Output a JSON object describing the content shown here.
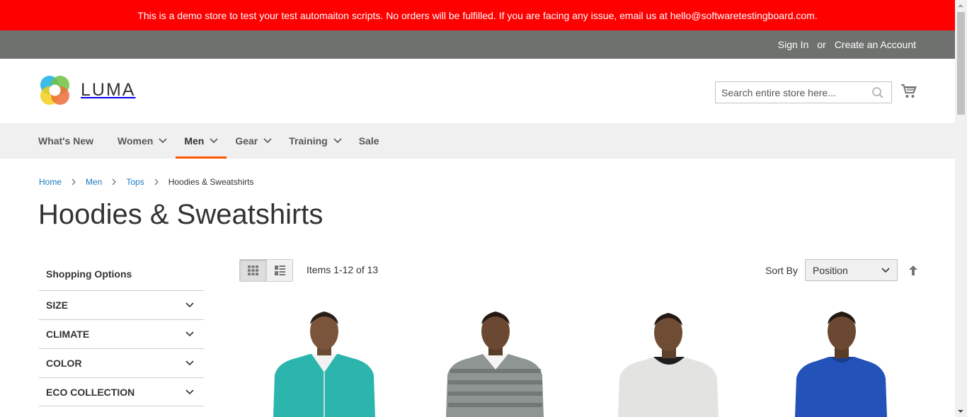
{
  "demo_notice": "This is a demo store to test your test automaiton scripts. No orders will be fulfilled. If you are facing any issue, email us at hello@softwaretestingboard.com.",
  "panel": {
    "sign_in": "Sign In",
    "or": "or",
    "create_account": "Create an Account"
  },
  "logo": {
    "text": "LUMA"
  },
  "search": {
    "placeholder": "Search entire store here..."
  },
  "nav": {
    "items": [
      {
        "label": "What's New"
      },
      {
        "label": "Women"
      },
      {
        "label": "Men"
      },
      {
        "label": "Gear"
      },
      {
        "label": "Training"
      },
      {
        "label": "Sale"
      }
    ]
  },
  "breadcrumbs": {
    "home": "Home",
    "men": "Men",
    "tops": "Tops",
    "current": "Hoodies & Sweatshirts"
  },
  "page_title": "Hoodies & Sweatshirts",
  "sidebar": {
    "title": "Shopping Options",
    "filters": [
      {
        "label": "SIZE"
      },
      {
        "label": "CLIMATE"
      },
      {
        "label": "COLOR"
      },
      {
        "label": "ECO COLLECTION"
      }
    ]
  },
  "toolbar": {
    "amount": "Items 1-12 of 13",
    "sort_label": "Sort By",
    "sort_value": "Position"
  },
  "colors": {
    "demo_bar": "#ff0000",
    "panel": "#6e716e",
    "nav_bg": "#f0f0f0",
    "nav_active": "#ff5501",
    "link": "#1979c3"
  },
  "products": [
    {
      "image": "teal-zip-hoodie"
    },
    {
      "image": "gray-striped-hoodie"
    },
    {
      "image": "light-gray-sweatshirt"
    },
    {
      "image": "blue-long-sleeve"
    }
  ]
}
